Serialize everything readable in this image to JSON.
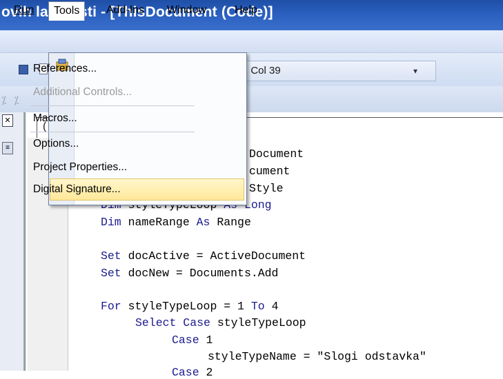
{
  "window": {
    "title": "ovih lastnosti - [ThisDocument (Code)]"
  },
  "menubar": {
    "run": "Run",
    "tools": "Tools",
    "addins": "Add-Ins",
    "window": "Window",
    "help": "Help"
  },
  "toolbar": {
    "position_status": ", Col 39"
  },
  "left_combo": {
    "char": "("
  },
  "tools_menu": {
    "items": [
      {
        "label": "References...",
        "enabled": true
      },
      {
        "label": "Additional Controls...",
        "enabled": false
      },
      {
        "label": "Macros...",
        "enabled": true
      },
      {
        "label": "Options...",
        "enabled": true
      },
      {
        "label": "Project Properties...",
        "enabled": true
      },
      {
        "label": "Digital Signature...",
        "enabled": true,
        "highlighted": true
      }
    ]
  },
  "code": {
    "l1": "Document",
    "l2": "cument",
    "l3": "Style",
    "l4_kw1": "Dim",
    "l4_rest": " styleTypeLoop ",
    "l4_kw2": "As Long",
    "l5_kw1": "Dim",
    "l5_rest": " nameRange ",
    "l5_kw2": "As",
    "l5_rest2": " Range",
    "l6_kw": "Set",
    "l6_rest": " docActive = ActiveDocument",
    "l7_kw": "Set",
    "l7_rest": " docNew = Documents.Add",
    "l8_kw1": "For",
    "l8_rest": " styleTypeLoop = 1 ",
    "l8_kw2": "To",
    "l8_rest2": " 4",
    "l9_kw": "Select Case",
    "l9_rest": " styleTypeLoop",
    "l10_kw": "Case",
    "l10_rest": " 1",
    "l11": "styleTypeName = \"Slogi odstavka\"",
    "l12_kw": "Case",
    "l12_rest": " 2"
  },
  "colors": {
    "titlebar": "#2a5fbf",
    "highlight": "#ffe89a",
    "keyword": "#1b1b8e"
  }
}
